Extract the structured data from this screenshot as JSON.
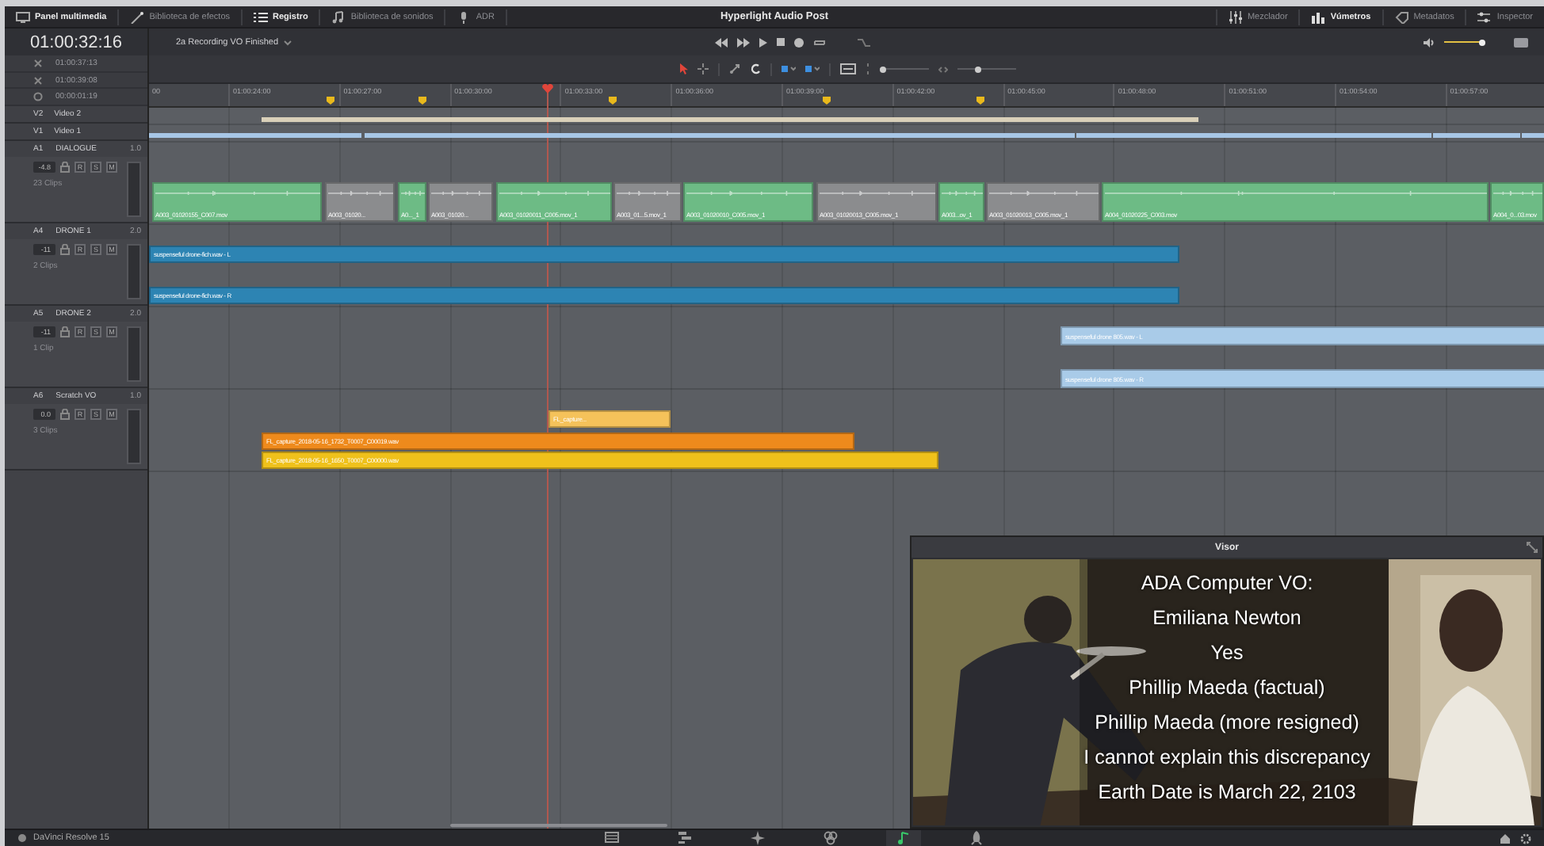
{
  "menu_bar": {
    "left": [
      {
        "label": "Panel multimedia",
        "selected": true
      },
      {
        "label": "Biblioteca de efectos",
        "selected": false
      },
      {
        "label": "Registro",
        "selected": true
      },
      {
        "label": "Biblioteca de sonidos",
        "selected": false
      },
      {
        "label": "ADR",
        "selected": false
      }
    ],
    "title": "Hyperlight Audio Post",
    "right": [
      {
        "label": "Mezclador",
        "selected": false
      },
      {
        "label": "Vúmetros",
        "selected": true
      },
      {
        "label": "Metadatos",
        "selected": false
      },
      {
        "label": "Inspector",
        "selected": false
      }
    ]
  },
  "timecode": "01:00:32:16",
  "timeline_name": "2a Recording VO Finished",
  "monitor_volume": {
    "level": 1
  },
  "toolbar": {
    "zoom_sliders": [
      {
        "level": 0.05
      },
      {
        "level": 0.35
      }
    ]
  },
  "timecode_rows": [
    "01:00:37:13",
    "01:00:39:08",
    "00:00:01:19"
  ],
  "ruler_labels": [
    "00",
    "01:00:24:00",
    "01:00:27:00",
    "01:00:30:00",
    "01:00:33:00",
    "01:00:36:00",
    "01:00:39:00",
    "01:00:42:00",
    "01:00:45:00",
    "01:00:48:00",
    "01:00:51:00",
    "01:00:54:00",
    "01:00:57:00"
  ],
  "video_tracks": [
    {
      "id": "V2",
      "name": "Video 2"
    },
    {
      "id": "V1",
      "name": "Video 1"
    }
  ],
  "audio_tracks": [
    {
      "id": "A1",
      "name": "DIALOGUE",
      "format": "1.0",
      "volume": "-4.8",
      "buttons": [
        "R",
        "S",
        "M"
      ],
      "clip_count": "23 Clips",
      "clips": [
        {
          "name": "A003_01020155_C007.mov",
          "color": "#6dbb85"
        },
        {
          "name": "A003_01020...",
          "color": "#8b8c8e"
        },
        {
          "name": "A0..._1",
          "color": "#6dbb85"
        },
        {
          "name": "A003_01020...",
          "color": "#8b8c8e"
        },
        {
          "name": "A003_01020011_C005.mov_1",
          "color": "#6dbb85"
        },
        {
          "name": "A003_01...5.mov_1",
          "color": "#8b8c8e"
        },
        {
          "name": "A003_01020010_C005.mov_1",
          "color": "#6dbb85"
        },
        {
          "name": "A003_01020013_C005.mov_1",
          "color": "#8b8c8e"
        },
        {
          "name": "A003...ov_1",
          "color": "#6dbb85"
        },
        {
          "name": "A003_01020013_C005.mov_1",
          "color": "#8b8c8e"
        },
        {
          "name": "A004_01020225_C003.mov",
          "color": "#6dbb85"
        },
        {
          "name": "A004_0...03.mov",
          "color": "#6dbb85"
        }
      ]
    },
    {
      "id": "A4",
      "name": "DRONE 1",
      "format": "2.0",
      "volume": "-11",
      "buttons": [
        "R",
        "S",
        "M"
      ],
      "clip_count": "2 Clips",
      "clips": [
        {
          "name": "suspenseful drone-fich.wav - L",
          "color": "#2d84b3"
        },
        {
          "name": "suspenseful drone-fich.wav - R",
          "color": "#2d84b3"
        }
      ]
    },
    {
      "id": "A5",
      "name": "DRONE 2",
      "format": "2.0",
      "volume": "-11",
      "buttons": [
        "R",
        "S",
        "M"
      ],
      "clip_count": "1 Clip",
      "clips": [
        {
          "name": "suspenseful drone 805.wav - L",
          "color": "#a9cbe8"
        },
        {
          "name": "suspenseful drone 805.wav - R",
          "color": "#a9cbe8"
        }
      ]
    },
    {
      "id": "A6",
      "name": "Scratch VO",
      "format": "1.0",
      "volume": "0.0",
      "buttons": [
        "R",
        "S",
        "M"
      ],
      "clip_count": "3 Clips",
      "clips": [
        {
          "name": "FL_capture...",
          "color": "#f5c25a"
        },
        {
          "name": "FL_capture_2018-05-16_1732_T0007_C00019.wav",
          "color": "#ee8a1c"
        },
        {
          "name": "FL_capture_2018-05-16_1650_T0007_C00000.wav",
          "color": "#efc11b"
        }
      ]
    }
  ],
  "viewer": {
    "title": "Visor",
    "subtitles": [
      "ADA Computer VO:",
      "Emiliana Newton",
      "Yes",
      "Phillip Maeda (factual)",
      "Phillip Maeda (more resigned)",
      "I cannot explain this discrepancy",
      "Earth Date is March 22, 2103"
    ]
  },
  "status_bar": {
    "app_name": "DaVinci Resolve 15",
    "pages": [
      {
        "selected": false
      },
      {
        "selected": false
      },
      {
        "selected": false
      },
      {
        "selected": false
      },
      {
        "selected": true
      },
      {
        "selected": false
      }
    ]
  }
}
